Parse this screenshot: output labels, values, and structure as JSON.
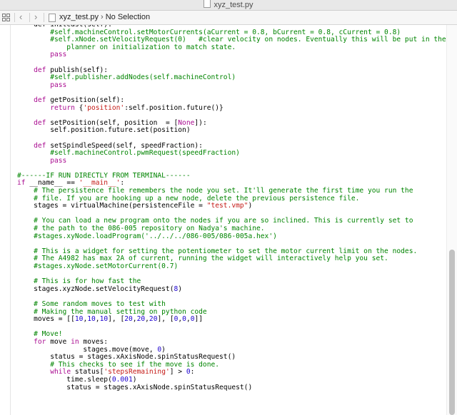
{
  "window": {
    "title": "xyz_test.py"
  },
  "navbar": {
    "filename": "xyz_test.py",
    "arrow": "›",
    "selection": "No Selection"
  },
  "code_lines": [
    [
      {
        "t": "    def initcast(self):",
        "c": ""
      }
    ],
    [
      {
        "t": "        #self.machineControl.setMotorCurrents(aCurrent = 0.8, bCurrent = 0.8, cCurrent = 0.8)",
        "c": "c"
      }
    ],
    [
      {
        "t": "        #self.xNode.setVelocityRequest(0)   #clear velocity on nodes. Eventually this will be put in the motion",
        "c": "c"
      }
    ],
    [
      {
        "t": "            planner on initialization to match state.",
        "c": "c"
      }
    ],
    [
      {
        "t": "        ",
        "c": ""
      },
      {
        "t": "pass",
        "c": "k"
      }
    ],
    [],
    [
      {
        "t": "    ",
        "c": ""
      },
      {
        "t": "def",
        "c": "k"
      },
      {
        "t": " publish(self):",
        "c": ""
      }
    ],
    [
      {
        "t": "        #self.publisher.addNodes(self.machineControl)",
        "c": "c"
      }
    ],
    [
      {
        "t": "        ",
        "c": ""
      },
      {
        "t": "pass",
        "c": "k"
      }
    ],
    [],
    [
      {
        "t": "    ",
        "c": ""
      },
      {
        "t": "def",
        "c": "k"
      },
      {
        "t": " getPosition(self):",
        "c": ""
      }
    ],
    [
      {
        "t": "        ",
        "c": ""
      },
      {
        "t": "return",
        "c": "k"
      },
      {
        "t": " {",
        "c": ""
      },
      {
        "t": "'position'",
        "c": "s"
      },
      {
        "t": ":self.position.future()}",
        "c": ""
      }
    ],
    [],
    [
      {
        "t": "    ",
        "c": ""
      },
      {
        "t": "def",
        "c": "k"
      },
      {
        "t": " setPosition(self, position  = [",
        "c": ""
      },
      {
        "t": "None",
        "c": "k"
      },
      {
        "t": "]):",
        "c": ""
      }
    ],
    [
      {
        "t": "        self.position.future.set(position)",
        "c": ""
      }
    ],
    [],
    [
      {
        "t": "    ",
        "c": ""
      },
      {
        "t": "def",
        "c": "k"
      },
      {
        "t": " setSpindleSpeed(self, speedFraction):",
        "c": ""
      }
    ],
    [
      {
        "t": "        #self.machineControl.pwmRequest(speedFraction)",
        "c": "c"
      }
    ],
    [
      {
        "t": "        ",
        "c": ""
      },
      {
        "t": "pass",
        "c": "k"
      }
    ],
    [],
    [
      {
        "t": "#------IF RUN DIRECTLY FROM TERMINAL------",
        "c": "c"
      }
    ],
    [
      {
        "t": "if",
        "c": "k"
      },
      {
        "t": " __name__ == ",
        "c": ""
      },
      {
        "t": "'__main__'",
        "c": "s"
      },
      {
        "t": ":",
        "c": ""
      }
    ],
    [
      {
        "t": "    # The persistence file remembers the node you set. It'll generate the first time you run the",
        "c": "c"
      }
    ],
    [
      {
        "t": "    # file. If you are hooking up a new node, delete the previous persistence file.",
        "c": "c"
      }
    ],
    [
      {
        "t": "    stages = virtualMachine(persistenceFile = ",
        "c": ""
      },
      {
        "t": "\"test.vmp\"",
        "c": "s"
      },
      {
        "t": ")",
        "c": ""
      }
    ],
    [],
    [
      {
        "t": "    # You can load a new program onto the nodes if you are so inclined. This is currently set to",
        "c": "c"
      }
    ],
    [
      {
        "t": "    # the path to the 086-005 repository on Nadya's machine.",
        "c": "c"
      }
    ],
    [
      {
        "t": "    #stages.xyNode.loadProgram('../../../086-005/086-005a.hex')",
        "c": "c"
      }
    ],
    [],
    [
      {
        "t": "    # This is a widget for setting the potentiometer to set the motor current limit on the nodes.",
        "c": "c"
      }
    ],
    [
      {
        "t": "    # The A4982 has max 2A of current, running the widget will interactively help you set.",
        "c": "c"
      }
    ],
    [
      {
        "t": "    #stages.xyNode.setMotorCurrent(0.7)",
        "c": "c"
      }
    ],
    [],
    [
      {
        "t": "    # This is for how fast the",
        "c": "c"
      }
    ],
    [
      {
        "t": "    stages.xyzNode.setVelocityRequest(",
        "c": ""
      },
      {
        "t": "8",
        "c": "n"
      },
      {
        "t": ")",
        "c": ""
      }
    ],
    [],
    [
      {
        "t": "    # Some random moves to test with",
        "c": "c"
      }
    ],
    [
      {
        "t": "    # Making the manual setting on python code",
        "c": "c"
      }
    ],
    [
      {
        "t": "    moves = [[",
        "c": ""
      },
      {
        "t": "10",
        "c": "n"
      },
      {
        "t": ",",
        "c": ""
      },
      {
        "t": "10",
        "c": "n"
      },
      {
        "t": ",",
        "c": ""
      },
      {
        "t": "10",
        "c": "n"
      },
      {
        "t": "], [",
        "c": ""
      },
      {
        "t": "20",
        "c": "n"
      },
      {
        "t": ",",
        "c": ""
      },
      {
        "t": "20",
        "c": "n"
      },
      {
        "t": ",",
        "c": ""
      },
      {
        "t": "20",
        "c": "n"
      },
      {
        "t": "], [",
        "c": ""
      },
      {
        "t": "0",
        "c": "n"
      },
      {
        "t": ",",
        "c": ""
      },
      {
        "t": "0",
        "c": "n"
      },
      {
        "t": ",",
        "c": ""
      },
      {
        "t": "0",
        "c": "n"
      },
      {
        "t": "]]",
        "c": ""
      }
    ],
    [],
    [
      {
        "t": "    # Move!",
        "c": "c"
      }
    ],
    [
      {
        "t": "    ",
        "c": ""
      },
      {
        "t": "for",
        "c": "k"
      },
      {
        "t": " move ",
        "c": ""
      },
      {
        "t": "in",
        "c": "k"
      },
      {
        "t": " moves:",
        "c": ""
      }
    ],
    [
      {
        "t": "                stages.move(move, ",
        "c": ""
      },
      {
        "t": "0",
        "c": "n"
      },
      {
        "t": ")",
        "c": ""
      }
    ],
    [
      {
        "t": "        status = stages.xAxisNode.spinStatusRequest()",
        "c": ""
      }
    ],
    [
      {
        "t": "        # This checks to see if the move is done.",
        "c": "c"
      }
    ],
    [
      {
        "t": "        ",
        "c": ""
      },
      {
        "t": "while",
        "c": "k"
      },
      {
        "t": " status[",
        "c": ""
      },
      {
        "t": "'stepsRemaining'",
        "c": "s"
      },
      {
        "t": "] > ",
        "c": ""
      },
      {
        "t": "0",
        "c": "n"
      },
      {
        "t": ":",
        "c": ""
      }
    ],
    [
      {
        "t": "            time.sleep(",
        "c": ""
      },
      {
        "t": "0.001",
        "c": "n"
      },
      {
        "t": ")",
        "c": ""
      }
    ],
    [
      {
        "t": "            status = stages.xAxisNode.spinStatusRequest()",
        "c": ""
      }
    ]
  ]
}
